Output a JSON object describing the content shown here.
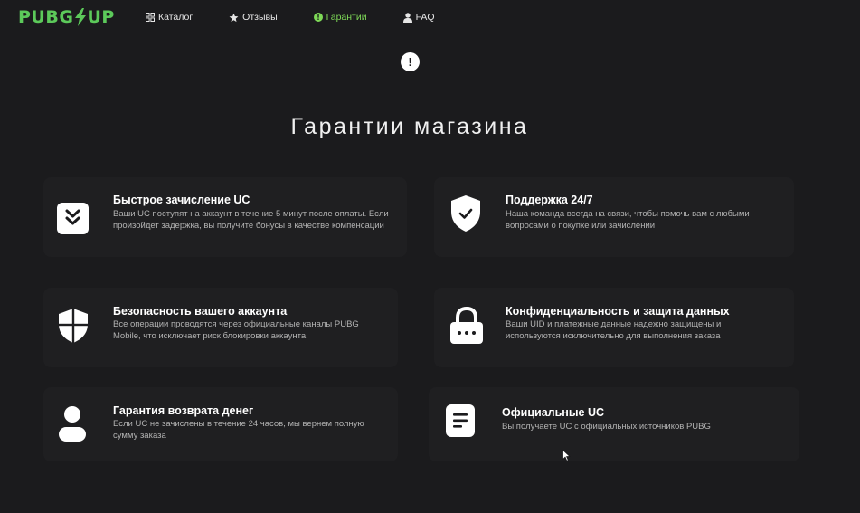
{
  "header": {
    "logo": {
      "left": "PUBG",
      "right": "UP"
    },
    "nav": [
      {
        "label": "Каталог",
        "icon": "grid-icon"
      },
      {
        "label": "Отзывы",
        "icon": "star-icon"
      },
      {
        "label": "Гарантии",
        "icon": "info-icon",
        "active": true
      },
      {
        "label": "FAQ",
        "icon": "user-icon"
      }
    ]
  },
  "alert_icon_glyph": "!",
  "page": {
    "title": "Гарантии магазина"
  },
  "cards": [
    {
      "title": "Быстрое зачисление UC",
      "desc": "Ваши UC поступят на аккаунт в течение 5 минут после оплаты. Если произойдет задержка, вы получите бонусы в качестве компенсации",
      "icon": "double-chevron-down-icon"
    },
    {
      "title": "Поддержка 24/7",
      "desc": "Наша команда всегда на связи, чтобы помочь вам с любыми вопросами о покупке или зачислении",
      "icon": "shield-check-icon"
    },
    {
      "title": "Безопасность вашего аккаунта",
      "desc": "Все операции проводятся через официальные каналы PUBG Mobile, что исключает риск блокировки аккаунта",
      "icon": "shield-icon"
    },
    {
      "title": "Конфиденциальность и защита данных",
      "desc": "Ваши UID и платежные данные надежно защищены и используются исключительно для выполнения заказа",
      "icon": "lock-icon"
    },
    {
      "title": "Гарантия возврата денег",
      "desc": "Если UC не зачислены в течение 24 часов, мы вернем полную сумму заказа",
      "icon": "person-icon"
    },
    {
      "title": "Официальные UC",
      "desc": "Вы получаете UC с официальных источников PUBG",
      "icon": "document-icon"
    }
  ],
  "colors": {
    "background": "#1b1b1d",
    "card": "#1f1f21",
    "accent": "#7ed957",
    "logo": "#5cc95a"
  }
}
